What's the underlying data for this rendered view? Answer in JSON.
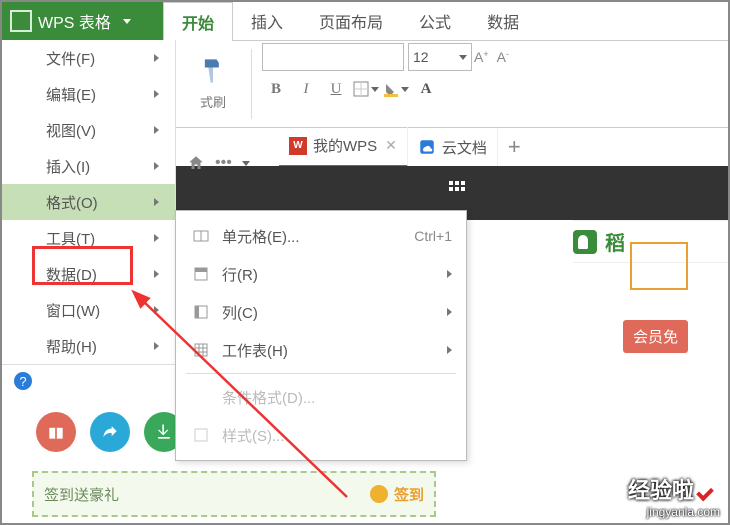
{
  "app": {
    "title": "WPS 表格"
  },
  "ribbon_tabs": {
    "start": "开始",
    "insert": "插入",
    "layout": "页面布局",
    "formula": "公式",
    "data": "数据"
  },
  "format_painter": "式刷",
  "font_size": "12",
  "font_buttons": {
    "bold": "B",
    "italic": "I",
    "underline": "U"
  },
  "doc_tabs": {
    "mywps": "我的WPS",
    "cloud": "云文档"
  },
  "main_menu": {
    "file": "文件(F)",
    "edit": "编辑(E)",
    "view": "视图(V)",
    "insert": "插入(I)",
    "format": "格式(O)",
    "tools": "工具(T)",
    "data": "数据(D)",
    "window": "窗口(W)",
    "help": "帮助(H)"
  },
  "sub_menu": {
    "cell": "单元格(E)...",
    "cell_shortcut": "Ctrl+1",
    "row": "行(R)",
    "col": "列(C)",
    "sheet": "工作表(H)",
    "cond": "条件格式(D)...",
    "style": "样式(S)..."
  },
  "right": {
    "dao": "稻",
    "member": "会员免"
  },
  "signin": {
    "label": "签到送豪礼",
    "btn": "签到"
  },
  "watermark": {
    "main": "经验啦",
    "sub": "jingyanla.com"
  }
}
